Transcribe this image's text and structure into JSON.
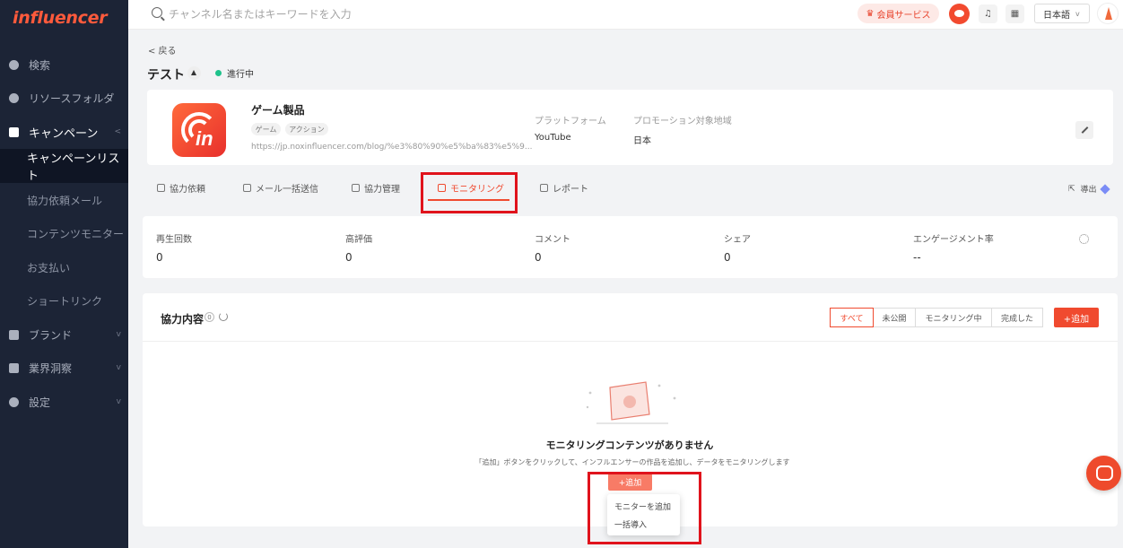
{
  "brand": {
    "logo_text": "influencer"
  },
  "sidebar": {
    "items": [
      {
        "label": "検索",
        "icon": "compass-icon"
      },
      {
        "label": "リソースフォルダ",
        "icon": "heart-icon"
      },
      {
        "label": "キャンペーン",
        "icon": "document-icon"
      },
      {
        "label": "ブランド",
        "icon": "brand-icon"
      },
      {
        "label": "業界洞察",
        "icon": "chart-icon"
      },
      {
        "label": "設定",
        "icon": "gear-icon"
      }
    ],
    "campaign_sub": [
      {
        "label": "キャンペーンリスト"
      },
      {
        "label": "協力依頼メール"
      },
      {
        "label": "コンテンツモニター"
      },
      {
        "label": "お支払い"
      },
      {
        "label": "ショートリンク"
      }
    ]
  },
  "topbar": {
    "search_placeholder": "チャンネル名またはキーワードを入力",
    "member_service": "会員サービス",
    "language": "日本語"
  },
  "header": {
    "back": "< 戻る",
    "title": "テスト",
    "status": "進行中"
  },
  "product": {
    "name": "ゲーム製品",
    "tags": [
      "ゲーム",
      "アクション"
    ],
    "url": "https://jp.noxinfluencer.com/blog/%e3%80%90%e5%ba%83%e5%9...",
    "platform_label": "プラットフォーム",
    "platform_value": "YouTube",
    "region_label": "プロモーション対象地域",
    "region_value": "日本"
  },
  "tabs": [
    {
      "label": "協力依頼"
    },
    {
      "label": "メール一括送信"
    },
    {
      "label": "協力管理"
    },
    {
      "label": "モニタリング"
    },
    {
      "label": "レポート"
    }
  ],
  "export_label": "導出",
  "stats": [
    {
      "label": "再生回数",
      "value": "0"
    },
    {
      "label": "高評価",
      "value": "0"
    },
    {
      "label": "コメント",
      "value": "0"
    },
    {
      "label": "シェア",
      "value": "0"
    },
    {
      "label": "エンゲージメント率",
      "value": "--"
    }
  ],
  "content": {
    "title": "協力内容",
    "count": "0",
    "filters": [
      "すべて",
      "未公開",
      "モニタリング中",
      "完成した"
    ],
    "add_button": "+追加",
    "empty_title": "モニタリングコンテンツがありません",
    "empty_desc": "「追加」ボタンをクリックして、インフルエンサーの作品を追加し、データをモニタリングします",
    "empty_add_button": "+追加",
    "dropdown_items": [
      "モニターを追加",
      "一括導入"
    ]
  },
  "colors": {
    "accent": "#f04a2f",
    "sidebar_bg": "#1c2436",
    "highlight": "#e0131c"
  }
}
